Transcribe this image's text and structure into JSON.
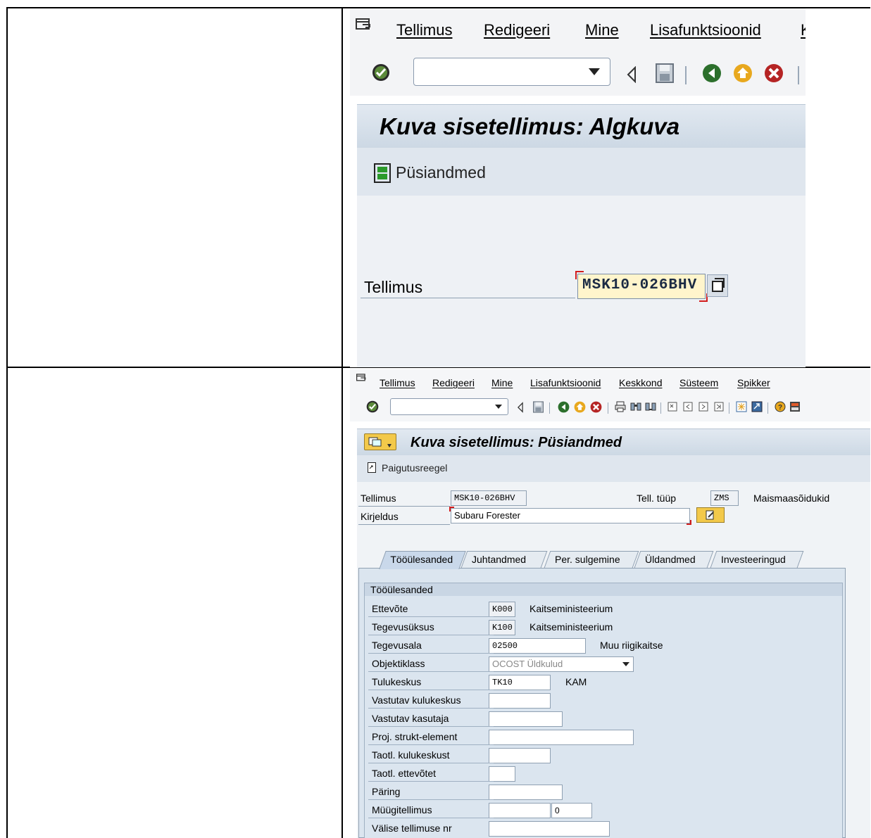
{
  "top": {
    "menu": [
      "Tellimus",
      "Redigeeri",
      "Mine",
      "Lisafunktsioonid",
      "K"
    ],
    "title": "Kuva sisetellimus: Algkuva",
    "app_button": "Püsiandmed",
    "field_label": "Tellimus",
    "field_value": "MSK10-026BHV"
  },
  "bottom": {
    "menu": [
      "Tellimus",
      "Redigeeri",
      "Mine",
      "Lisafunktsioonid",
      "Keskkond",
      "Süsteem",
      "Spikker"
    ],
    "title": "Kuva sisetellimus: Püsiandmed",
    "app_button": "Paigutusreegel",
    "header": {
      "tellimus_label": "Tellimus",
      "tellimus_value": "MSK10-026BHV",
      "type_label": "Tell. tüüp",
      "type_value": "ZMS",
      "type_text": "Maismaasõidukid",
      "desc_label": "Kirjeldus",
      "desc_value": "Subaru Forester"
    },
    "tabs": [
      "Tööülesanded",
      "Juhtandmed",
      "Per. sulgemine",
      "Üldandmed",
      "Investeeringud"
    ],
    "group_title": "Tööülesanded",
    "rows": [
      {
        "label": "Ettevõte",
        "value": "K000",
        "text": "Kaitseministeerium"
      },
      {
        "label": "Tegevusüksus",
        "value": "K100",
        "text": "Kaitseministeerium"
      },
      {
        "label": "Tegevusala",
        "value": "02500",
        "text": "Muu riigikaitse"
      },
      {
        "label": "Objektiklass",
        "value": "OCOST Üldkulud",
        "text": ""
      },
      {
        "label": "Tulukeskus",
        "value": "TK10",
        "text": "KAM"
      },
      {
        "label": "Vastutav kulukeskus",
        "value": "",
        "text": ""
      },
      {
        "label": "Vastutav kasutaja",
        "value": "",
        "text": ""
      },
      {
        "label": "Proj. strukt-element",
        "value": "",
        "text": ""
      },
      {
        "label": "Taotl. kulukeskust",
        "value": "",
        "text": ""
      },
      {
        "label": "Taotl. ettevõtet",
        "value": "",
        "text": ""
      },
      {
        "label": "Päring",
        "value": "",
        "text": ""
      },
      {
        "label": "Müügitellimus",
        "value": "",
        "text": "0"
      },
      {
        "label": "Välise tellimuse nr",
        "value": "",
        "text": ""
      }
    ]
  },
  "colors": {
    "accent": "#d21d1d",
    "title_bg": "#d5dfea",
    "panel_bg": "#dbe5ef",
    "highlight": "#fff5cc"
  }
}
